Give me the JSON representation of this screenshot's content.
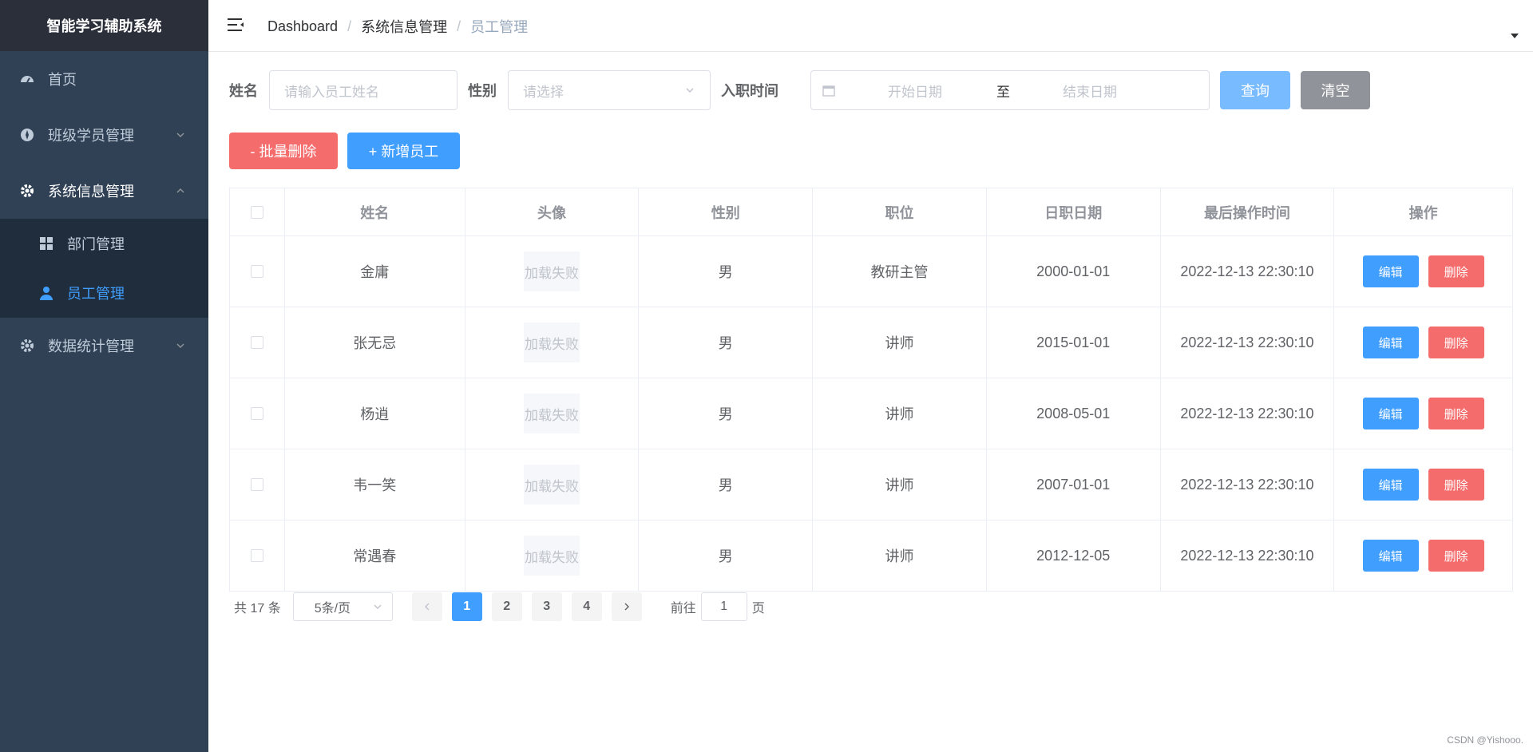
{
  "sidebar": {
    "brand": "智能学习辅助系统",
    "items": [
      {
        "label": "首页"
      },
      {
        "label": "班级学员管理"
      },
      {
        "label": "系统信息管理"
      },
      {
        "label": "数据统计管理"
      }
    ],
    "sub_items": [
      {
        "label": "部门管理"
      },
      {
        "label": "员工管理"
      }
    ]
  },
  "header": {
    "breadcrumb": [
      "Dashboard",
      "系统信息管理",
      "员工管理"
    ]
  },
  "search": {
    "name_label": "姓名",
    "name_placeholder": "请输入员工姓名",
    "gender_label": "性别",
    "gender_placeholder": "请选择",
    "date_label": "入职时间",
    "start_placeholder": "开始日期",
    "range_sep": "至",
    "end_placeholder": "结束日期",
    "query_btn": "查询",
    "clear_btn": "清空"
  },
  "actions": {
    "batch_delete": "- 批量删除",
    "add_employee": "+ 新增员工"
  },
  "table": {
    "headers": [
      "姓名",
      "头像",
      "性别",
      "职位",
      "日职日期",
      "最后操作时间",
      "操作"
    ],
    "avatar_fail": "加载失败",
    "edit_label": "编辑",
    "delete_label": "删除",
    "rows": [
      {
        "name": "金庸",
        "gender": "男",
        "job": "教研主管",
        "entry": "2000-01-01",
        "updated": "2022-12-13 22:30:10"
      },
      {
        "name": "张无忌",
        "gender": "男",
        "job": "讲师",
        "entry": "2015-01-01",
        "updated": "2022-12-13 22:30:10"
      },
      {
        "name": "杨逍",
        "gender": "男",
        "job": "讲师",
        "entry": "2008-05-01",
        "updated": "2022-12-13 22:30:10"
      },
      {
        "name": "韦一笑",
        "gender": "男",
        "job": "讲师",
        "entry": "2007-01-01",
        "updated": "2022-12-13 22:30:10"
      },
      {
        "name": "常遇春",
        "gender": "男",
        "job": "讲师",
        "entry": "2012-12-05",
        "updated": "2022-12-13 22:30:10"
      }
    ]
  },
  "pagination": {
    "total": "共 17 条",
    "page_size": "5条/页",
    "pages": [
      "1",
      "2",
      "3",
      "4"
    ],
    "goto_label": "前往",
    "goto_value": "1",
    "goto_suffix": "页"
  },
  "footer": "CSDN @Yishooo.",
  "colors": {
    "sidebar_bg": "#304156",
    "brand_bg": "#2b2f3a",
    "submenu_bg": "#1f2d3d",
    "primary": "#409eff",
    "danger": "#f56c6c",
    "query_btn": "#79bbff",
    "clear_btn": "#909399"
  }
}
